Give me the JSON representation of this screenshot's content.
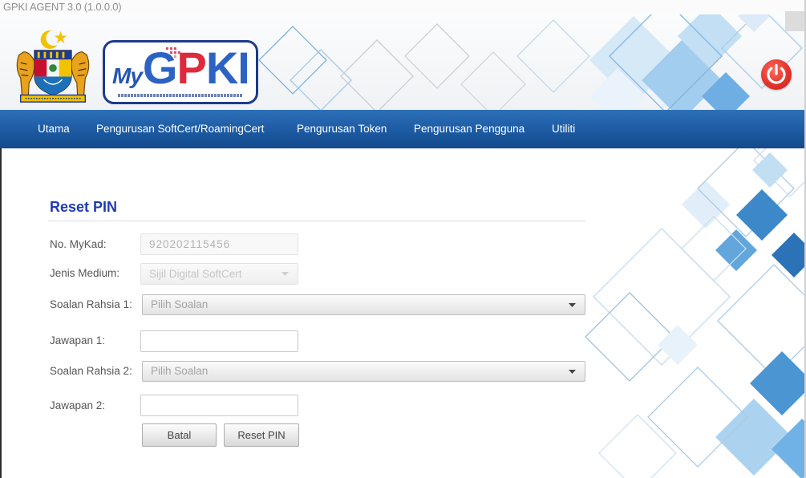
{
  "window": {
    "title": "GPKI AGENT 3.0 (1.0.0.0)"
  },
  "header": {
    "logo": {
      "my": "My",
      "g": "G",
      "p": "P",
      "ki": "KI"
    },
    "crest_icon": "coat-of-arms-icon",
    "power_icon": "power-icon"
  },
  "nav": {
    "items": [
      {
        "label": "Utama"
      },
      {
        "label": "Pengurusan SoftCert/RoamingCert"
      },
      {
        "label": "Pengurusan Token"
      },
      {
        "label": "Pengurusan Pengguna"
      },
      {
        "label": "Utiliti"
      }
    ]
  },
  "form": {
    "title": "Reset PIN",
    "mykad": {
      "label": "No. MyKad:",
      "value": "920202115456",
      "disabled": true
    },
    "medium": {
      "label": "Jenis Medium:",
      "value": "Sijil Digital SoftCert",
      "disabled": true
    },
    "question1": {
      "label": "Soalan Rahsia 1:",
      "selected": "Pilih Soalan"
    },
    "answer1": {
      "label": "Jawapan 1:"
    },
    "question2": {
      "label": "Soalan Rahsia 2:",
      "selected": "Pilih Soalan"
    },
    "answer2": {
      "label": "Jawapan 2:"
    },
    "buttons": {
      "cancel": "Batal",
      "submit": "Reset PIN"
    },
    "dropdown_icon": "chevron-down-icon"
  },
  "colors": {
    "nav_bg": "#1c5aa2",
    "heading": "#1f3bb3",
    "power": "#e3342a",
    "logo_border": "#1d3b8c",
    "pattern_blue": "#3d88c8"
  }
}
